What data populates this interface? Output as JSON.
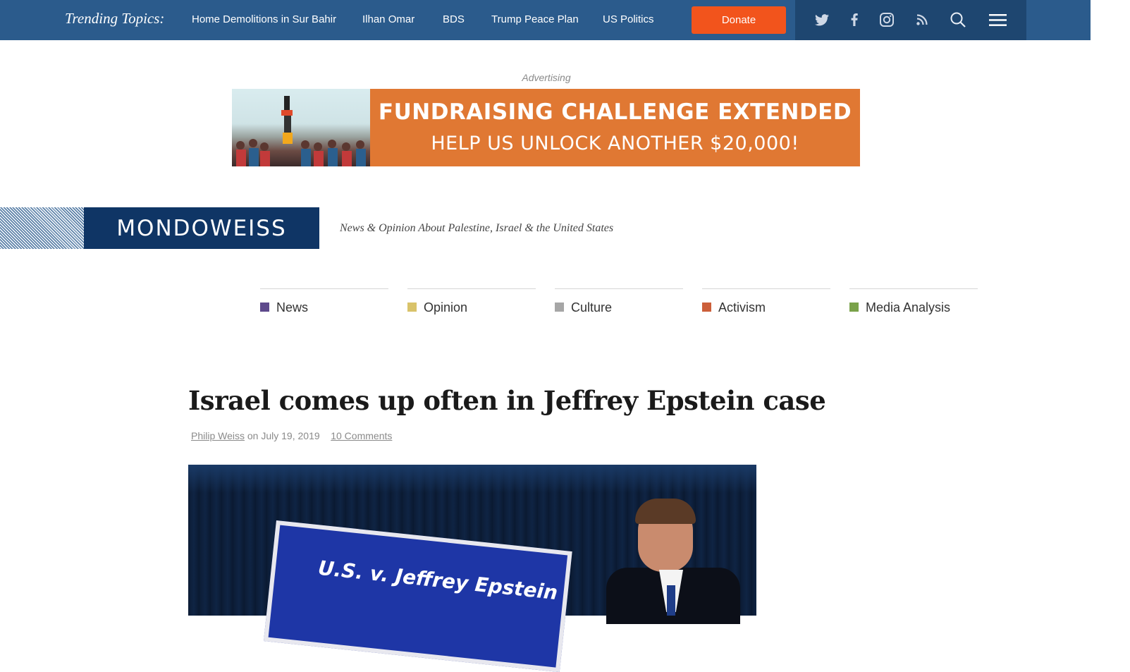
{
  "top_bar": {
    "trending_label": "Trending Topics:",
    "topics": [
      "Home Demolitions in Sur Bahir",
      "Ilhan Omar",
      "BDS",
      "Trump Peace Plan",
      "US Politics"
    ],
    "donate_label": "Donate",
    "icons": [
      "twitter-icon",
      "facebook-icon",
      "instagram-icon",
      "rss-icon",
      "search-icon",
      "menu-icon"
    ],
    "colors": {
      "bar": "#2b5b8c",
      "icon_bar": "#1e4670",
      "donate": "#f2541c"
    }
  },
  "ad": {
    "label": "Advertising",
    "line1": "FUNDRAISING CHALLENGE EXTENDED",
    "line2": "HELP US UNLOCK ANOTHER $20,000!",
    "color": "#e07833"
  },
  "masthead": {
    "logo": "MONDOWEISS",
    "tagline": "News & Opinion About Palestine, Israel & the United States",
    "logo_color": "#0f3565"
  },
  "categories": [
    {
      "label": "News",
      "color": "#5e4a8c"
    },
    {
      "label": "Opinion",
      "color": "#d9c36a"
    },
    {
      "label": "Culture",
      "color": "#a6a6a6"
    },
    {
      "label": "Activism",
      "color": "#cc5f3a"
    },
    {
      "label": "Media Analysis",
      "color": "#7aa24a"
    }
  ],
  "article": {
    "title": "Israel comes up often in Jeffrey Epstein case",
    "author": "Philip Weiss",
    "date_prefix": "on",
    "date": "July 19, 2019",
    "comments": "10 Comments",
    "image_sign_text": "U.S. v. Jeffrey Epstein"
  }
}
